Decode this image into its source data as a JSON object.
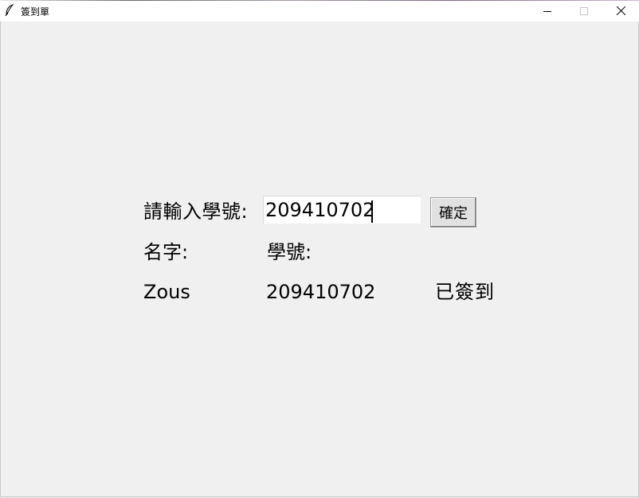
{
  "window": {
    "title": "簽到單",
    "icon": "feather-icon",
    "controls": [
      "minimize-icon",
      "maximize-icon",
      "close-icon"
    ]
  },
  "form": {
    "prompt_label": "請輸入學號:",
    "student_id_value": "209410702",
    "confirm_label": "確定"
  },
  "table": {
    "headers": {
      "name": "名字:",
      "student_id": "學號:"
    },
    "rows": [
      {
        "name": "Zous",
        "student_id": "209410702",
        "status": "已簽到"
      }
    ]
  },
  "colors": {
    "background": "#f0f0f0",
    "titlebar": "#ffffff",
    "text": "#000000"
  }
}
